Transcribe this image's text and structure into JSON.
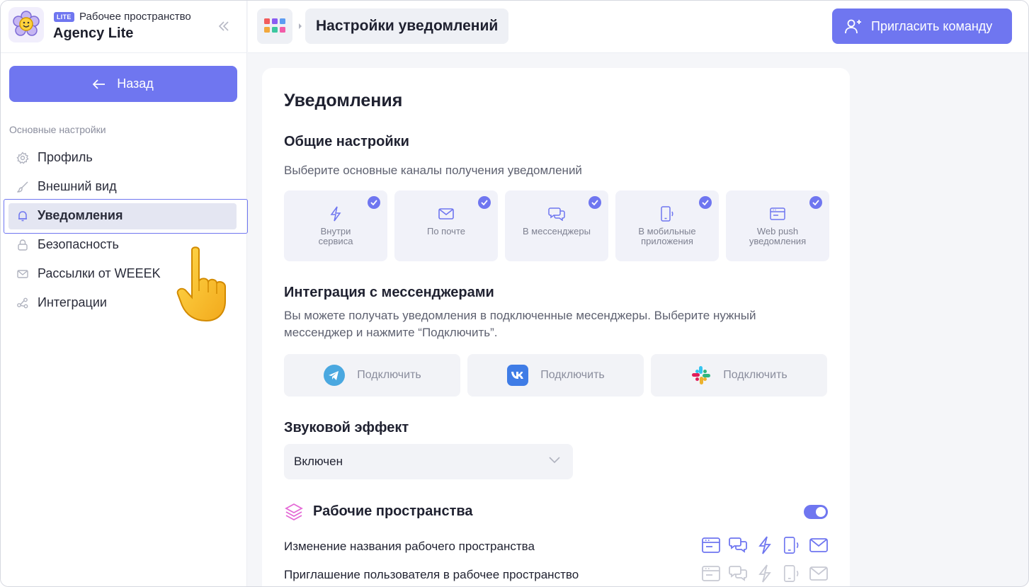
{
  "workspace": {
    "badge": "LITE",
    "label": "Рабочее пространство",
    "name": "Agency Lite"
  },
  "sidebar": {
    "back_label": "Назад",
    "section_title": "Основные настройки",
    "items": [
      {
        "label": "Профиль",
        "icon": "gear-icon"
      },
      {
        "label": "Внешний вид",
        "icon": "brush-icon"
      },
      {
        "label": "Уведомления",
        "icon": "bell-icon",
        "active": true
      },
      {
        "label": "Безопасность",
        "icon": "lock-icon"
      },
      {
        "label": "Рассылки от WEEEK",
        "icon": "mail-icon"
      },
      {
        "label": "Интеграции",
        "icon": "integrations-icon"
      }
    ]
  },
  "header": {
    "breadcrumb": "Настройки уведомлений",
    "invite_label": "Пригласить команду"
  },
  "main": {
    "title": "Уведомления",
    "general": {
      "title": "Общие настройки",
      "description": "Выберите основные каналы получения уведомлений",
      "channels": [
        {
          "label": "Внутри\nсервиса",
          "icon": "lightning-icon",
          "checked": true
        },
        {
          "label": "По почте",
          "icon": "mail-icon",
          "checked": true
        },
        {
          "label": "В мессенджеры",
          "icon": "chat-icon",
          "checked": true
        },
        {
          "label": "В мобильные\nприложения",
          "icon": "phone-icon",
          "checked": true
        },
        {
          "label": "Web push\nуведомления",
          "icon": "browser-icon",
          "checked": true
        }
      ]
    },
    "messengers": {
      "title": "Интеграция с мессенджерами",
      "description_line1": "Вы можете получать уведомления в подключенные месенджеры. Выберите нужный",
      "description_line2": "мессенджер и нажмите “Подключить”.",
      "connectors": [
        {
          "label": "Подключить",
          "icon": "telegram-icon"
        },
        {
          "label": "Подключить",
          "icon": "vk-icon"
        },
        {
          "label": "Подключить",
          "icon": "slack-icon"
        }
      ]
    },
    "sound": {
      "title": "Звуковой эффект",
      "value": "Включен"
    },
    "workspaces": {
      "title": "Рабочие пространства",
      "enabled": true,
      "events": [
        {
          "label": "Изменение названия рабочего пространства",
          "active": true
        },
        {
          "label": "Приглашение пользователя в рабочее пространство",
          "active": false
        }
      ]
    }
  },
  "colors": {
    "accent": "#6f76f0",
    "active_bg": "#e4e6f2",
    "muted_icon": "#c7c9d3"
  }
}
